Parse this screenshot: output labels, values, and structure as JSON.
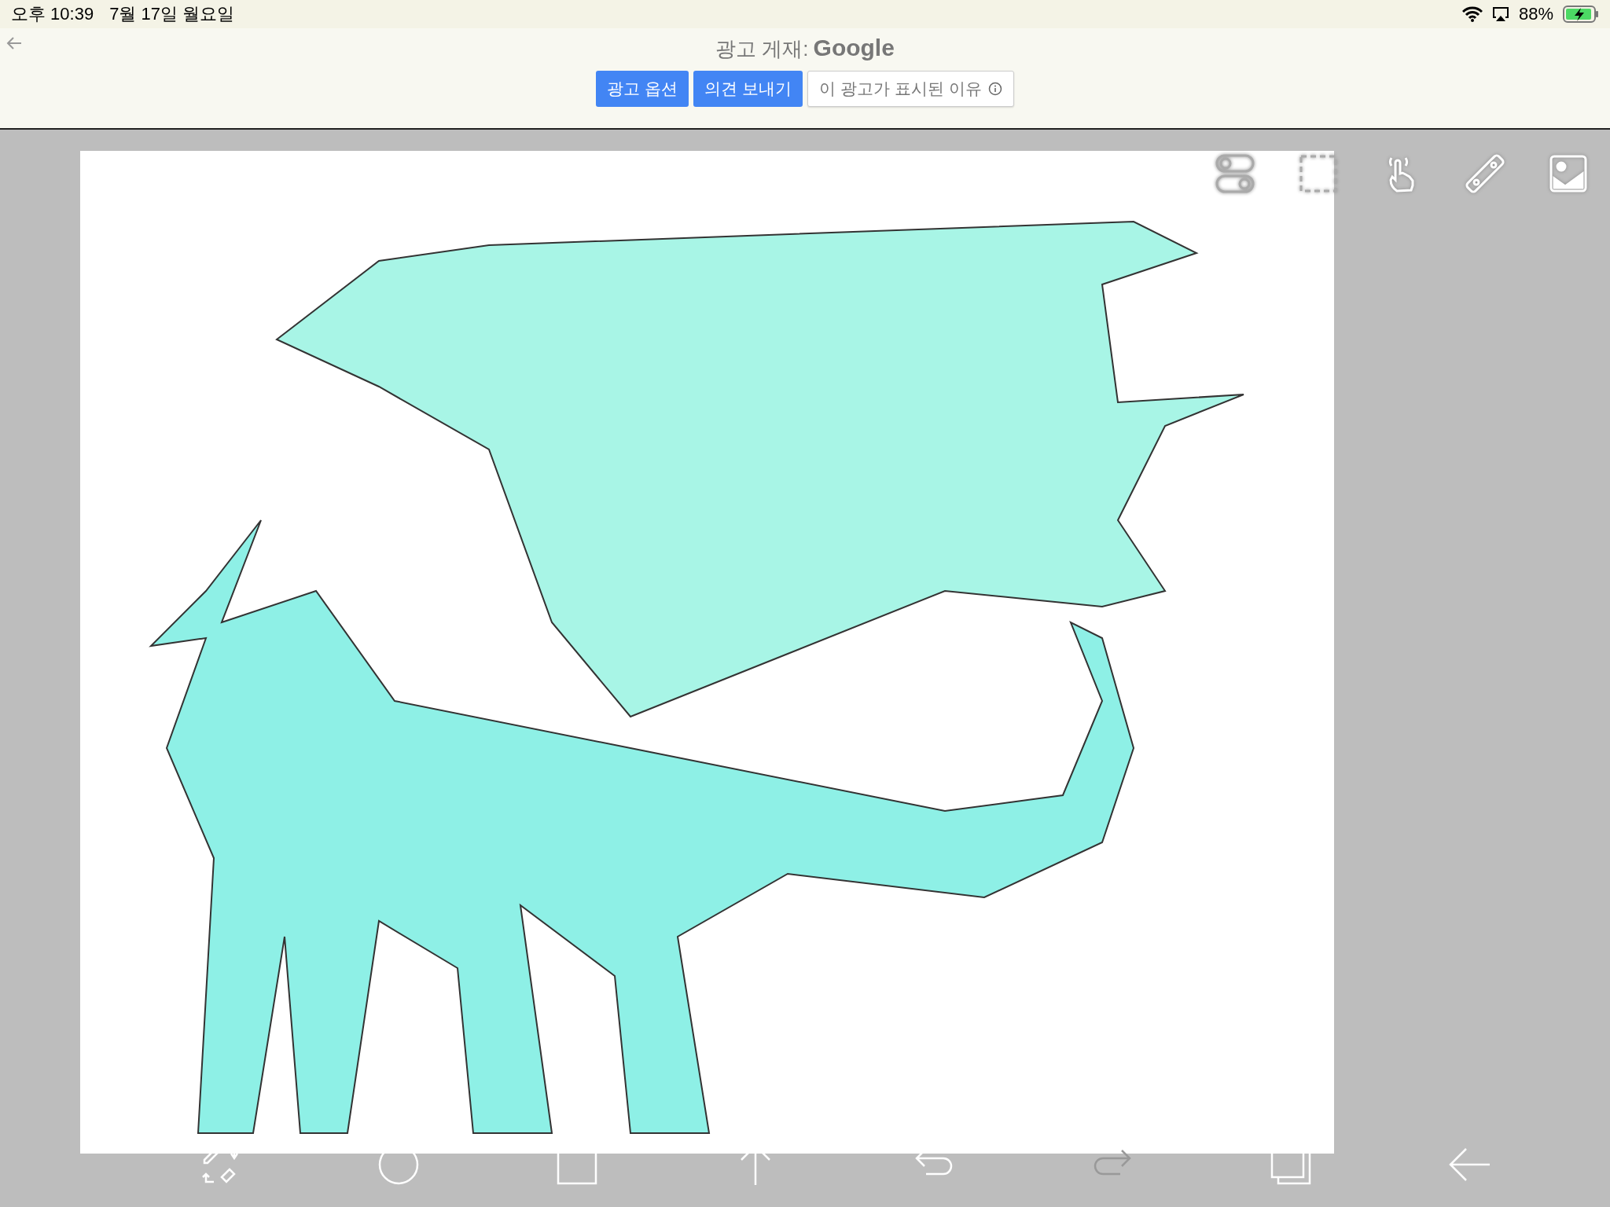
{
  "status_bar": {
    "time": "오후 10:39",
    "date": "7월 17일 월요일",
    "battery": "88%"
  },
  "ad_banner": {
    "label": "광고 게재:",
    "brand": "Google",
    "buttons": [
      {
        "label": "광고 옵션",
        "kind": "primary"
      },
      {
        "label": "의견 보내기",
        "kind": "primary"
      },
      {
        "label": "이 광고가 표시된 이유",
        "kind": "info"
      }
    ]
  },
  "top_tools": [
    {
      "kind": "toggles"
    },
    {
      "kind": "selection"
    },
    {
      "kind": "hand"
    },
    {
      "kind": "ruler"
    },
    {
      "kind": "image"
    }
  ],
  "bottom_tools": [
    {
      "kind": "pen-eraser",
      "disabled": false
    },
    {
      "kind": "circle",
      "disabled": false
    },
    {
      "kind": "square",
      "disabled": false
    },
    {
      "kind": "arrow-up",
      "disabled": false
    },
    {
      "kind": "undo",
      "disabled": false
    },
    {
      "kind": "redo",
      "disabled": true
    },
    {
      "kind": "layers",
      "disabled": false
    },
    {
      "kind": "back",
      "disabled": false
    }
  ]
}
